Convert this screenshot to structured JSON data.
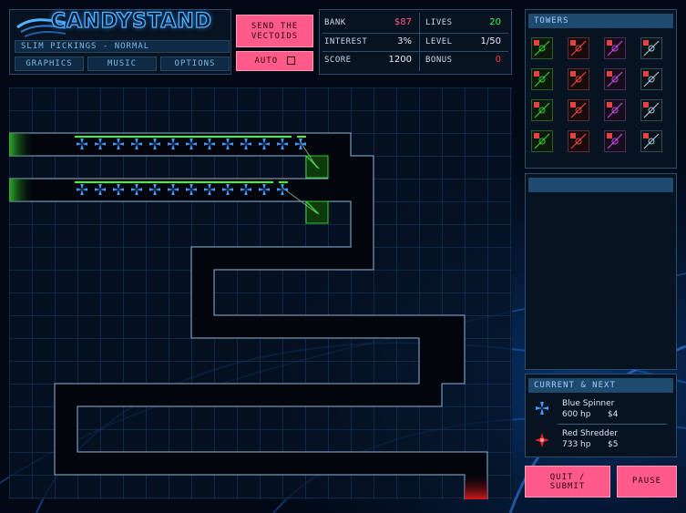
{
  "logo": {
    "text": "CANDYSTAND"
  },
  "level_title": "SLIM PICKINGS - NORMAL",
  "menu": {
    "graphics": "GRAPHICS",
    "music": "MUSIC",
    "options": "OPTIONS"
  },
  "send_button": {
    "line1": "SEND THE",
    "line2": "VECTOIDS"
  },
  "auto_button": {
    "label": "AUTO"
  },
  "stats": {
    "bank_label": "BANK",
    "bank_value": "$87",
    "interest_label": "INTEREST",
    "interest_value": "3%",
    "score_label": "SCORE",
    "score_value": "1200",
    "lives_label": "LIVES",
    "lives_value": "20",
    "level_label": "LEVEL",
    "level_value": "1/50",
    "bonus_label": "BONUS",
    "bonus_value": "0"
  },
  "colors": {
    "bank": "#ff5a8a",
    "lives": "#33ff55",
    "bonus": "#ff3333",
    "accent_pink": "#ff5a8a",
    "grid": "#1c3f66",
    "path_border": "#8fb4d8",
    "enemy_blue": "#3d9bff",
    "green_tower": "#33cc33"
  },
  "towers_panel": {
    "title": "TOWERS"
  },
  "towers": [
    {
      "name": "green-tower-1-icon"
    },
    {
      "name": "red-tower-1-icon"
    },
    {
      "name": "purple-tower-1-icon"
    },
    {
      "name": "blue-tower-1-icon"
    },
    {
      "name": "green-tower-2-icon"
    },
    {
      "name": "red-tower-2-icon"
    },
    {
      "name": "purple-tower-2-icon"
    },
    {
      "name": "blue-tower-2-icon"
    },
    {
      "name": "green-tower-3-icon"
    },
    {
      "name": "red-tower-3-icon"
    },
    {
      "name": "purple-tower-3-icon"
    },
    {
      "name": "blue-tower-3-icon"
    },
    {
      "name": "red-bomb-tower-icon"
    },
    {
      "name": "green-splash-tower-icon"
    },
    {
      "name": "gold-tower-icon"
    },
    {
      "name": "blue-swirl-tower-icon"
    }
  ],
  "current_next": {
    "title": "CURRENT & NEXT",
    "current": {
      "name": "Blue Spinner",
      "hp": "600 hp",
      "bounty": "$4",
      "icon": "blue-spinner-icon"
    },
    "next": {
      "name": "Red Shredder",
      "hp": "733 hp",
      "bounty": "$5",
      "icon": "red-shredder-icon"
    }
  },
  "buttons": {
    "quit_line1": "QUIT /",
    "quit_line2": "SUBMIT",
    "pause": "PAUSE"
  },
  "enemy_rows": {
    "top_row_count": 13,
    "bottom_row_count": 11
  }
}
